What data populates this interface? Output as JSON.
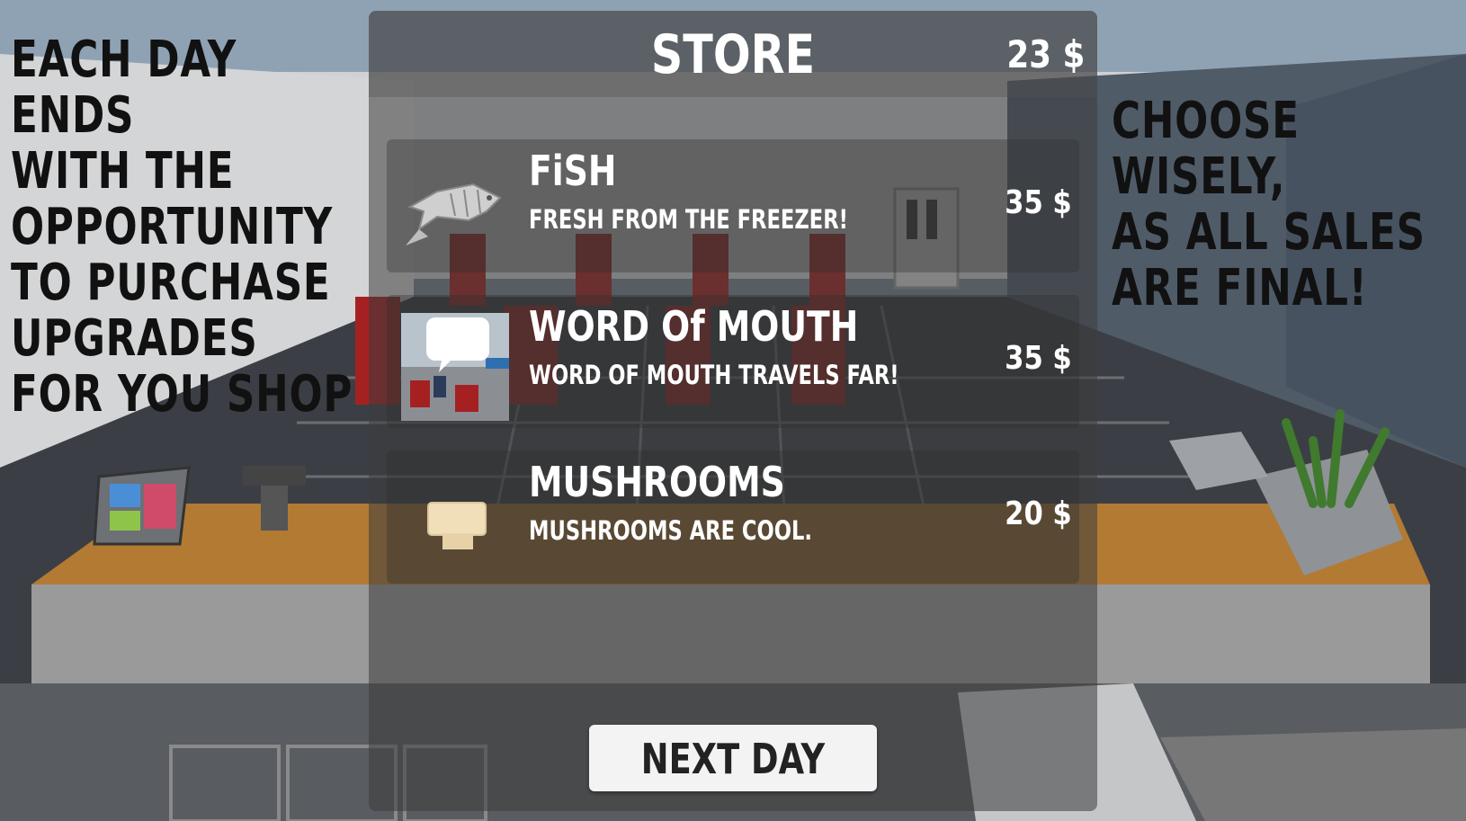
{
  "left_message": "Each day ends\nwith the\nopportunity\nto purchase\nupgrades\nfor you shop",
  "right_message": "Choose wisely,\nas all sales\nare final!",
  "store": {
    "title": "STORE",
    "money": "23 $",
    "items": [
      {
        "name": "FiSH",
        "description": "Fresh from The freezer!",
        "price": "35 $",
        "icon": "fish-icon"
      },
      {
        "name": "WORD Of MOUTH",
        "description": "Word of mouth travels far!",
        "price": "35 $",
        "icon": "word-of-mouth-icon"
      },
      {
        "name": "MUSHROOMS",
        "description": "Mushrooms are cool.",
        "price": "20 $",
        "icon": "mushroom-icon"
      }
    ]
  },
  "next_button": "NEXT DAY",
  "colors": {
    "panel": "#3c3c3c",
    "button": "#f3f3f3",
    "text_light": "#ffffff",
    "text_dark": "#111111"
  }
}
